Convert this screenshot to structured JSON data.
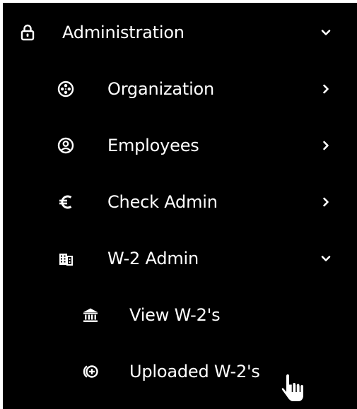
{
  "menu": {
    "items": [
      {
        "label": "Administration",
        "icon": "lock-icon",
        "state": "expanded"
      },
      {
        "label": "Organization",
        "icon": "film-reel-icon",
        "state": "collapsed"
      },
      {
        "label": "Employees",
        "icon": "user-circle-icon",
        "state": "collapsed"
      },
      {
        "label": "Check Admin",
        "icon": "euro-icon",
        "state": "collapsed"
      },
      {
        "label": "W-2 Admin",
        "icon": "building-icon",
        "state": "expanded"
      },
      {
        "label": "View W-2's",
        "icon": "bank-icon"
      },
      {
        "label": "Uploaded W-2's",
        "icon": "add-circle-icon"
      }
    ]
  },
  "colors": {
    "background": "#000000",
    "text": "#ffffff",
    "page": "#ffffff"
  },
  "cursor": "hand-pointer-icon"
}
